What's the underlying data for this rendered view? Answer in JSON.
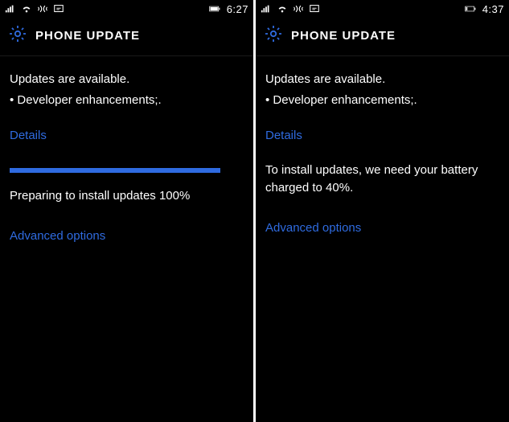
{
  "colors": {
    "accent": "#2f6be0"
  },
  "screens": [
    {
      "time": "6:27",
      "battery_state": "full",
      "title": "PHONE UPDATE",
      "status_line": "Updates are available.",
      "bullet": "• Developer enhancements;.",
      "details_label": "Details",
      "progress_pct": 100,
      "progress_text": "Preparing to install updates 100%",
      "advanced_label": "Advanced options"
    },
    {
      "time": "4:37",
      "battery_state": "low",
      "title": "PHONE UPDATE",
      "status_line": "Updates are available.",
      "bullet": "• Developer enhancements;.",
      "details_label": "Details",
      "notice": "To install updates, we need your battery charged to 40%.",
      "advanced_label": "Advanced options"
    }
  ]
}
